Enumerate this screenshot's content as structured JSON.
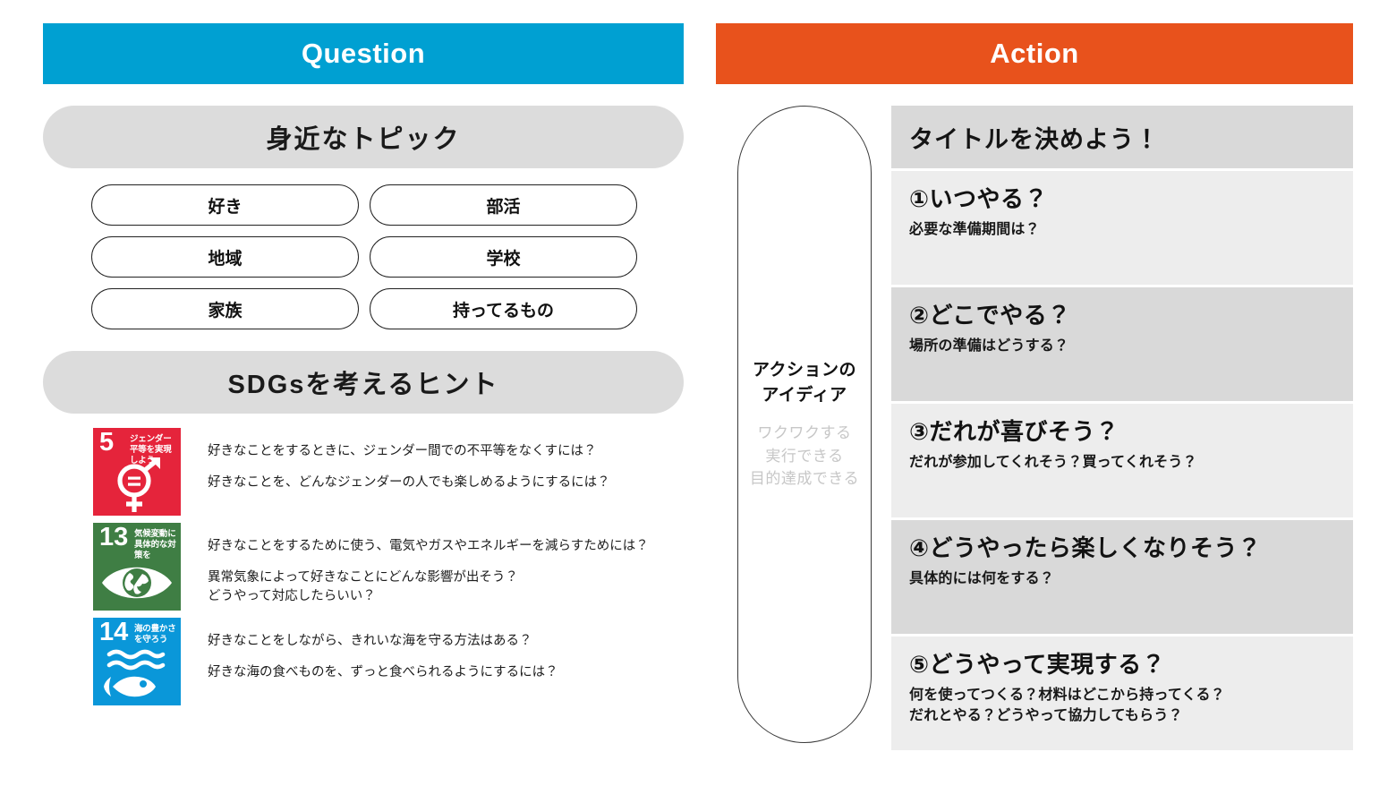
{
  "question": {
    "header": "Question",
    "topic_section_title": "身近なトピック",
    "topics": [
      "好き",
      "部活",
      "地域",
      "学校",
      "家族",
      "持ってるもの"
    ],
    "sdg_section_title": "SDGsを考えるヒント",
    "sdgs": [
      {
        "number": "5",
        "goal_label": "ジェンダー平等を実現しよう",
        "color": "#e5243b",
        "icon": "gender-equality-icon",
        "paragraphs": [
          [
            "好きなことをするときに、ジェンダー間での不平等をなくすには？"
          ],
          [
            "好きなことを、どんなジェンダーの人でも楽しめるようにするには？"
          ]
        ]
      },
      {
        "number": "13",
        "goal_label": "気候変動に具体的な対策を",
        "color": "#3f7e44",
        "icon": "climate-eye-globe-icon",
        "paragraphs": [
          [
            "好きなことをするために使う、電気やガスやエネルギーを減らすためには？"
          ],
          [
            "異常気象によって好きなことにどんな影響が出そう？",
            "どうやって対応したらいい？"
          ]
        ]
      },
      {
        "number": "14",
        "goal_label": "海の豊かさを守ろう",
        "color": "#0a97d9",
        "icon": "ocean-fish-waves-icon",
        "paragraphs": [
          [
            "好きなことをしながら、きれいな海を守る方法はある？"
          ],
          [
            "好きな海の食べものを、ずっと食べられるようにするには？"
          ]
        ]
      }
    ]
  },
  "action": {
    "header": "Action",
    "capsule": {
      "title_lines": [
        "アクションの",
        "アイディア"
      ],
      "sub_lines": [
        "ワクワクする",
        "実行できる",
        "目的達成できる"
      ]
    },
    "title_bar": "タイトルを決めよう！",
    "steps": [
      {
        "question": "①いつやる？",
        "sub_lines": [
          "必要な準備期間は？"
        ]
      },
      {
        "question": "②どこでやる？",
        "sub_lines": [
          "場所の準備はどうする？"
        ]
      },
      {
        "question": "③だれが喜びそう？",
        "sub_lines": [
          "だれが参加してくれそう？買ってくれそう？"
        ]
      },
      {
        "question": "④どうやったら楽しくなりそう？",
        "sub_lines": [
          "具体的には何をする？"
        ]
      },
      {
        "question": "⑤どうやって実現する？",
        "sub_lines": [
          "何を使ってつくる？材料はどこから持ってくる？",
          "だれとやる？どうやって協力してもらう？"
        ]
      }
    ]
  },
  "colors": {
    "question_header": "#00a0d2",
    "action_header": "#e8521c",
    "section_title_bg": "#dcdcdc",
    "row_dark": "#d9d9d9",
    "row_light": "#ededed",
    "capsule_sub_text": "#c7c7c7"
  }
}
